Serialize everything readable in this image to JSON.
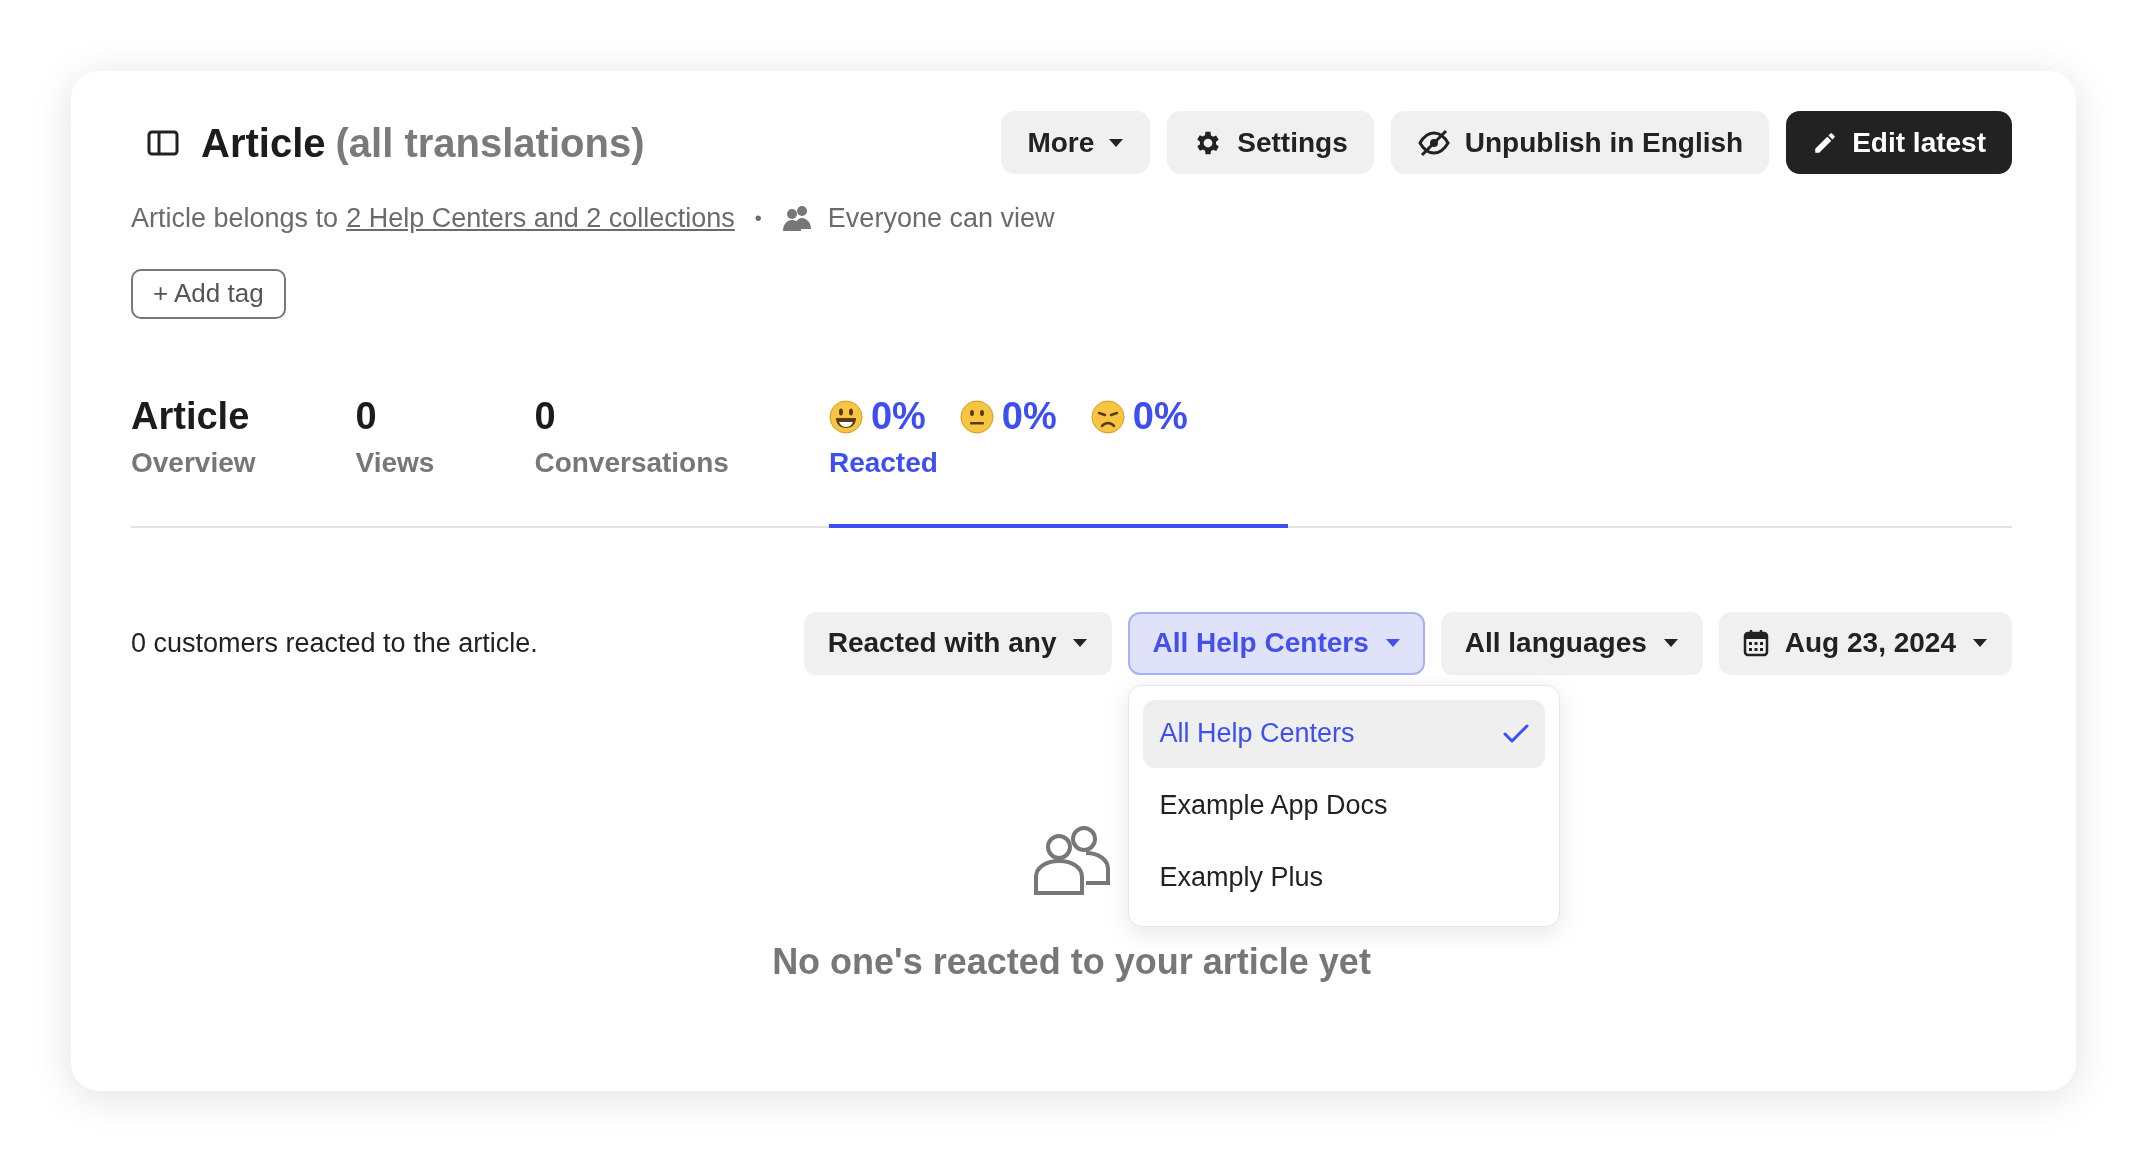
{
  "header": {
    "title": "Article",
    "subtitle": "(all translations)",
    "buttons": [
      {
        "label": "More",
        "kind": "menu"
      },
      {
        "label": "Settings",
        "kind": "settings"
      },
      {
        "label": "Unpublish in English",
        "kind": "unpublish"
      },
      {
        "label": "Edit latest",
        "kind": "primary"
      }
    ]
  },
  "meta": {
    "prefix": "Article belongs to",
    "link": "2 Help Centers and 2 collections",
    "separator": "•",
    "visibility": "Everyone can view"
  },
  "add_tag": "+ Add tag",
  "tabs": [
    {
      "kind": "stat",
      "value": "Article",
      "label": "Overview",
      "selected": false
    },
    {
      "kind": "stat",
      "value": "0",
      "label": "Views",
      "selected": false
    },
    {
      "kind": "stat",
      "value": "0",
      "label": "Conversations",
      "selected": false
    },
    {
      "kind": "reactions",
      "values": [
        "0%",
        "0%",
        "0%"
      ],
      "label": "Reacted",
      "selected": true
    }
  ],
  "filters": {
    "summary": "0 customers reacted to the article.",
    "buttons": [
      {
        "label": "Reacted with any",
        "kind": "select",
        "open": false
      },
      {
        "label": "All Help Centers",
        "kind": "select",
        "open": true
      },
      {
        "label": "All languages",
        "kind": "select",
        "open": false
      },
      {
        "label": "Aug 23, 2024",
        "kind": "date",
        "open": false
      }
    ]
  },
  "dropdown": {
    "items": [
      {
        "label": "All Help Centers",
        "selected": true
      },
      {
        "label": "Example App Docs",
        "selected": false
      },
      {
        "label": "Examply Plus",
        "selected": false
      }
    ]
  },
  "empty_state": {
    "message": "No one's reacted to your article yet"
  }
}
